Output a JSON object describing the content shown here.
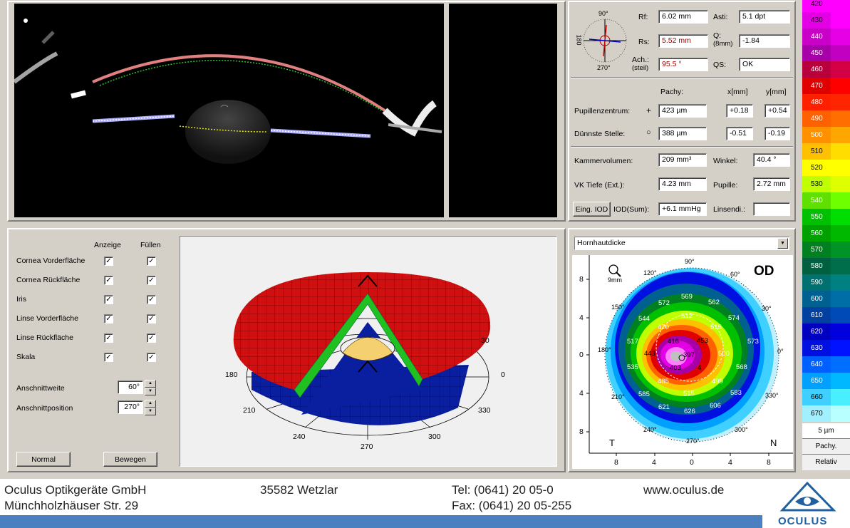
{
  "keratometry": {
    "rf_label": "Rf:",
    "rf_value": "6.02 mm",
    "rs_label": "Rs:",
    "rs_value": "5.52 mm",
    "ach_label": "Ach.:",
    "ach_sub": "(steil)",
    "ach_value": "95.5 °",
    "asti_label": "Asti:",
    "asti_value": "5.1 dpt",
    "q_label": "Q:",
    "q_sub": "(8mm)",
    "q_value": "-1.84",
    "qs_label": "QS:",
    "qs_value": "OK",
    "compass": {
      "top": "90°",
      "bottom": "270°",
      "left": "180",
      "right": "0"
    }
  },
  "pachy": {
    "header": "Pachy:",
    "x_header": "x[mm]",
    "y_header": "y[mm]",
    "pupil_label": "Pupillenzentrum:",
    "pupil_symbol": "+",
    "pupil_value": "423 µm",
    "pupil_x": "+0.18",
    "pupil_y": "+0.54",
    "thin_label": "Dünnste Stelle:",
    "thin_symbol": "○",
    "thin_value": "388 µm",
    "thin_x": "-0.51",
    "thin_y": "-0.19"
  },
  "chamber": {
    "volume_label": "Kammervolumen:",
    "volume_value": "209 mm³",
    "angle_label": "Winkel:",
    "angle_value": "40.4 °",
    "depth_label": "VK Tiefe (Ext.):",
    "depth_value": "4.23 mm",
    "pupil_label": "Pupille:",
    "pupil_value": "2.72 mm",
    "iod_button": "Eing. IOD",
    "iod_label": "IOD(Sum):",
    "iod_value": "+6.1 mmHg",
    "lens_label": "Linsendi.:",
    "lens_value": ""
  },
  "options": {
    "col_show": "Anzeige",
    "col_fill": "Füllen",
    "rows": [
      "Cornea Vorderfläche",
      "Cornea Rückfläche",
      "Iris",
      "Linse Vorderfläche",
      "Linse Rückfläche",
      "Skala"
    ],
    "check": "✓",
    "cut_width_label": "Anschnittweite",
    "cut_width_value": "60°",
    "cut_pos_label": "Anschnittposition",
    "cut_pos_value": "270°",
    "btn_normal": "Normal",
    "btn_move": "Bewegen"
  },
  "model3d": {
    "labels": [
      "180",
      "0",
      "30",
      "210",
      "330",
      "240",
      "300",
      "270"
    ]
  },
  "map": {
    "dropdown": "Hornhautdicke",
    "eye": "OD",
    "zoom": "9mm",
    "side_left": "T",
    "side_right": "N",
    "yticks": [
      "8",
      "4",
      "0",
      "4",
      "8"
    ],
    "xticks": [
      "8",
      "4",
      "0",
      "4",
      "8"
    ],
    "angles": [
      "90°",
      "60°",
      "30°",
      "0°",
      "330°",
      "300°",
      "270°",
      "240°",
      "210°",
      "180°",
      "150°",
      "120°"
    ],
    "values": [
      "569",
      "562",
      "572",
      "574",
      "544",
      "512",
      "515",
      "470",
      "517",
      "573",
      "416",
      "453",
      "443",
      "500",
      "397",
      "535",
      "403",
      "4",
      "568",
      "485",
      "499",
      "585",
      "515",
      "583",
      "621",
      "626",
      "606"
    ]
  },
  "scale": {
    "entries": [
      {
        "v": "420",
        "c": "#ff00ff"
      },
      {
        "v": "430",
        "c": "#e400e4"
      },
      {
        "v": "440",
        "c": "#c800c8"
      },
      {
        "v": "450",
        "c": "#a800a8"
      },
      {
        "v": "460",
        "c": "#b8003c"
      },
      {
        "v": "470",
        "c": "#e00000"
      },
      {
        "v": "480",
        "c": "#ff2000"
      },
      {
        "v": "490",
        "c": "#ff6000"
      },
      {
        "v": "500",
        "c": "#ff9000"
      },
      {
        "v": "510",
        "c": "#ffc000"
      },
      {
        "v": "520",
        "c": "#ffff00"
      },
      {
        "v": "530",
        "c": "#c0ff00"
      },
      {
        "v": "540",
        "c": "#60e000"
      },
      {
        "v": "550",
        "c": "#00c000"
      },
      {
        "v": "560",
        "c": "#00a000"
      },
      {
        "v": "570",
        "c": "#008020"
      },
      {
        "v": "580",
        "c": "#006040"
      },
      {
        "v": "590",
        "c": "#007070"
      },
      {
        "v": "600",
        "c": "#006090"
      },
      {
        "v": "610",
        "c": "#0040a0"
      },
      {
        "v": "620",
        "c": "#0000c0"
      },
      {
        "v": "630",
        "c": "#0010e0"
      },
      {
        "v": "640",
        "c": "#0060ff"
      },
      {
        "v": "650",
        "c": "#00a0ff"
      },
      {
        "v": "660",
        "c": "#40d0ff"
      },
      {
        "v": "670",
        "c": "#a0f0ff"
      }
    ],
    "step": "5 µm",
    "mode": "Pachy.",
    "rel": "Relativ"
  },
  "footer": {
    "company": "Oculus Optikgeräte GmbH",
    "street": "Münchholzhäuser Str. 29",
    "city": "35582 Wetzlar",
    "tel": "Tel:  (0641) 20 05-0",
    "fax": "Fax: (0641) 20 05-255",
    "web": "www.oculus.de",
    "logo": "OCULUS"
  }
}
